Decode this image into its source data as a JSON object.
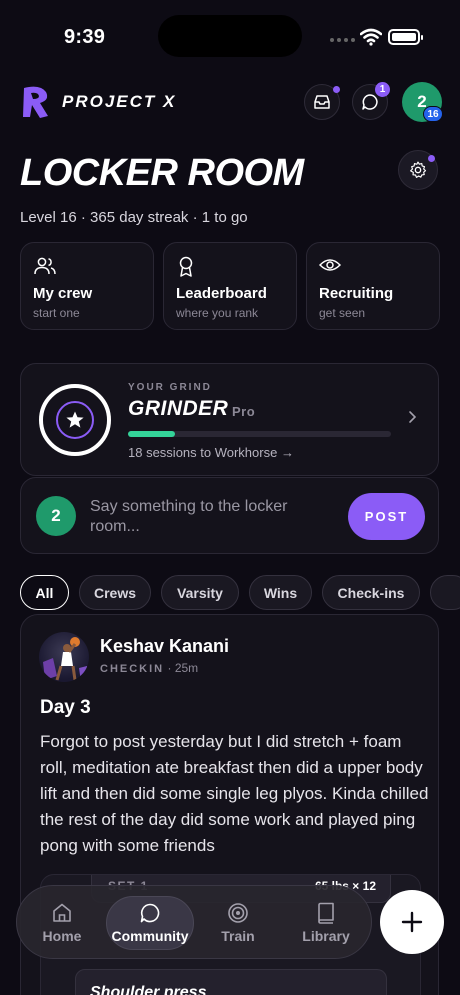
{
  "status_bar": {
    "time": "9:39"
  },
  "brand": {
    "name": "PROJECT X",
    "accent": "#8b5cf6"
  },
  "header": {
    "inbox_icon": "inbox-icon",
    "messages_badge": "1",
    "avatar_initial": "2",
    "level_badge": "16"
  },
  "page": {
    "title": "LOCKER ROOM",
    "subtitle": "Level 16 · 365 day streak · 1 to go"
  },
  "tiles": [
    {
      "title": "My crew",
      "sub": "start one",
      "icon": "people-icon"
    },
    {
      "title": "Leaderboard",
      "sub": "where you rank",
      "icon": "award-icon"
    },
    {
      "title": "Recruiting",
      "sub": "get seen",
      "icon": "eye-icon"
    }
  ],
  "grind": {
    "eyebrow": "YOUR GRIND",
    "rank": "GRINDER",
    "tier": "Pro",
    "progress": 0.18,
    "next": "18 sessions to Workhorse →",
    "progress_color": "#34d399"
  },
  "composer": {
    "avatar_initial": "2",
    "placeholder": "Say something to the locker room...",
    "post_label": "POST"
  },
  "filters": [
    "All",
    "Crews",
    "Varsity",
    "Wins",
    "Check-ins"
  ],
  "post": {
    "author": "Keshav Kanani",
    "tag": "CHECKIN",
    "time": "25m",
    "title": "Day 3",
    "body": "Forgot to post yesterday but I did stretch + foam roll, meditation ate breakfast then did a upper body lift and then did some single leg plyos. Kinda chilled the rest of the day did some work and played ping pong with some friends",
    "set_label": "SET 1",
    "set_value": "65 lbs × 12",
    "exercise": "Shoulder press"
  },
  "nav": [
    {
      "label": "Home",
      "icon": "home-icon"
    },
    {
      "label": "Community",
      "icon": "chat-icon",
      "active": true
    },
    {
      "label": "Train",
      "icon": "target-icon"
    },
    {
      "label": "Library",
      "icon": "book-icon"
    }
  ],
  "fab_icon": "plus-icon"
}
